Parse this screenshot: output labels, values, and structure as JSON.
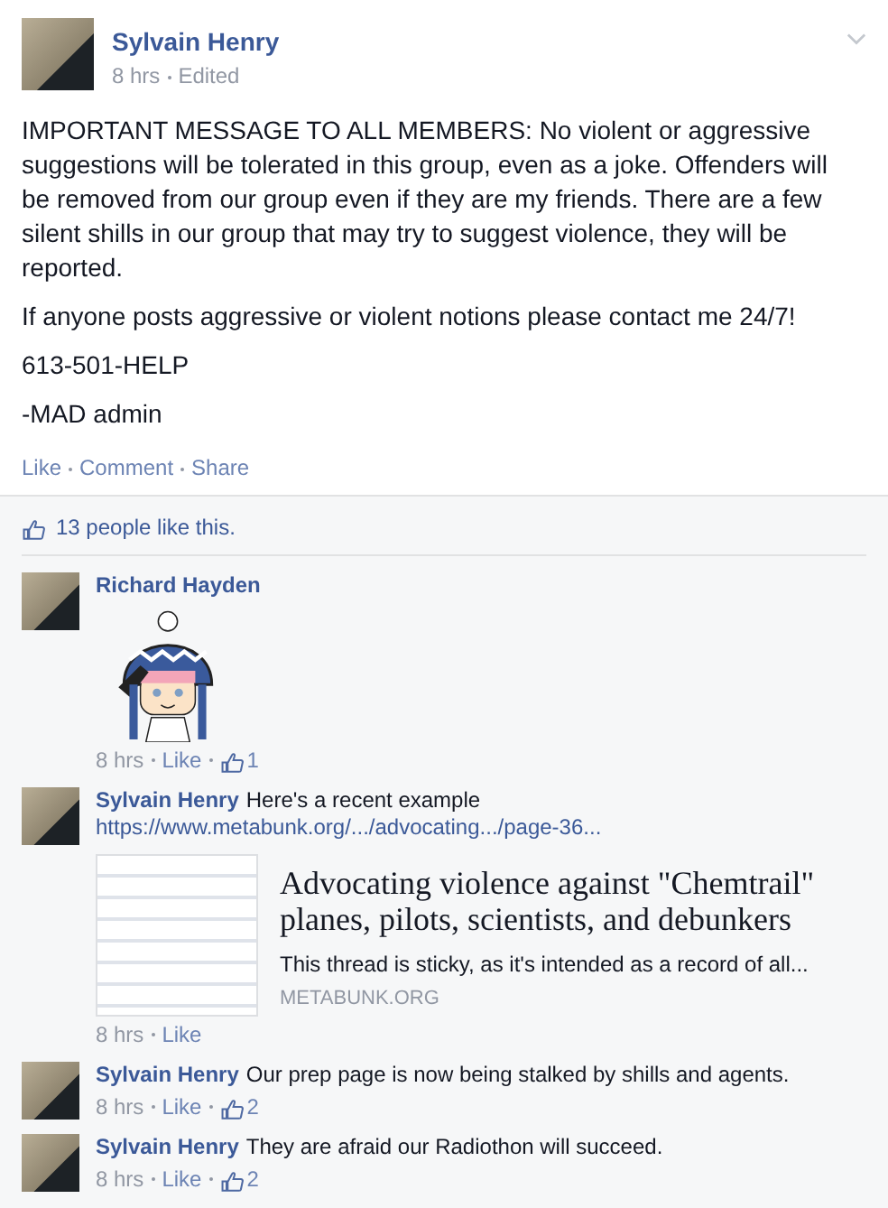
{
  "post": {
    "author": "Sylvain Henry",
    "time": "8 hrs",
    "edited": "Edited",
    "paragraphs": [
      "IMPORTANT MESSAGE TO ALL MEMBERS: No violent or aggressive suggestions will be tolerated in this group, even as a joke. Offenders will be removed from our group even if they are my friends. There are a few silent shills in our group that may try to suggest violence, they will be reported.",
      "If anyone posts aggressive or violent notions please contact me 24/7!",
      "613-501-HELP",
      "-MAD admin"
    ],
    "actions": [
      "Like",
      "Comment",
      "Share"
    ]
  },
  "likes_summary": "13 people like this.",
  "comments": [
    {
      "kind": "sticker",
      "author": "Richard Hayden",
      "time": "8 hrs",
      "like": "Like",
      "like_count": "1"
    },
    {
      "kind": "text",
      "author": "Sylvain Henry",
      "text": "Here's a recent example",
      "link": "https://www.metabunk.org/.../advocating.../page-36...",
      "attachment": {
        "title": "Advocating violence against \"Chemtrail\" planes, pilots, scientists, and debunkers",
        "description": "This thread is sticky, as it's intended as a record of all...",
        "domain": "METABUNK.ORG"
      },
      "time": "8 hrs",
      "like": "Like"
    },
    {
      "kind": "text",
      "author": "Sylvain Henry",
      "text": "Our prep page is now being stalked by shills and agents.",
      "time": "8 hrs",
      "like": "Like",
      "like_count": "2"
    },
    {
      "kind": "text",
      "author": "Sylvain Henry",
      "text": "They are afraid our Radiothon will succeed.",
      "time": "8 hrs",
      "like": "Like",
      "like_count": "2"
    }
  ]
}
